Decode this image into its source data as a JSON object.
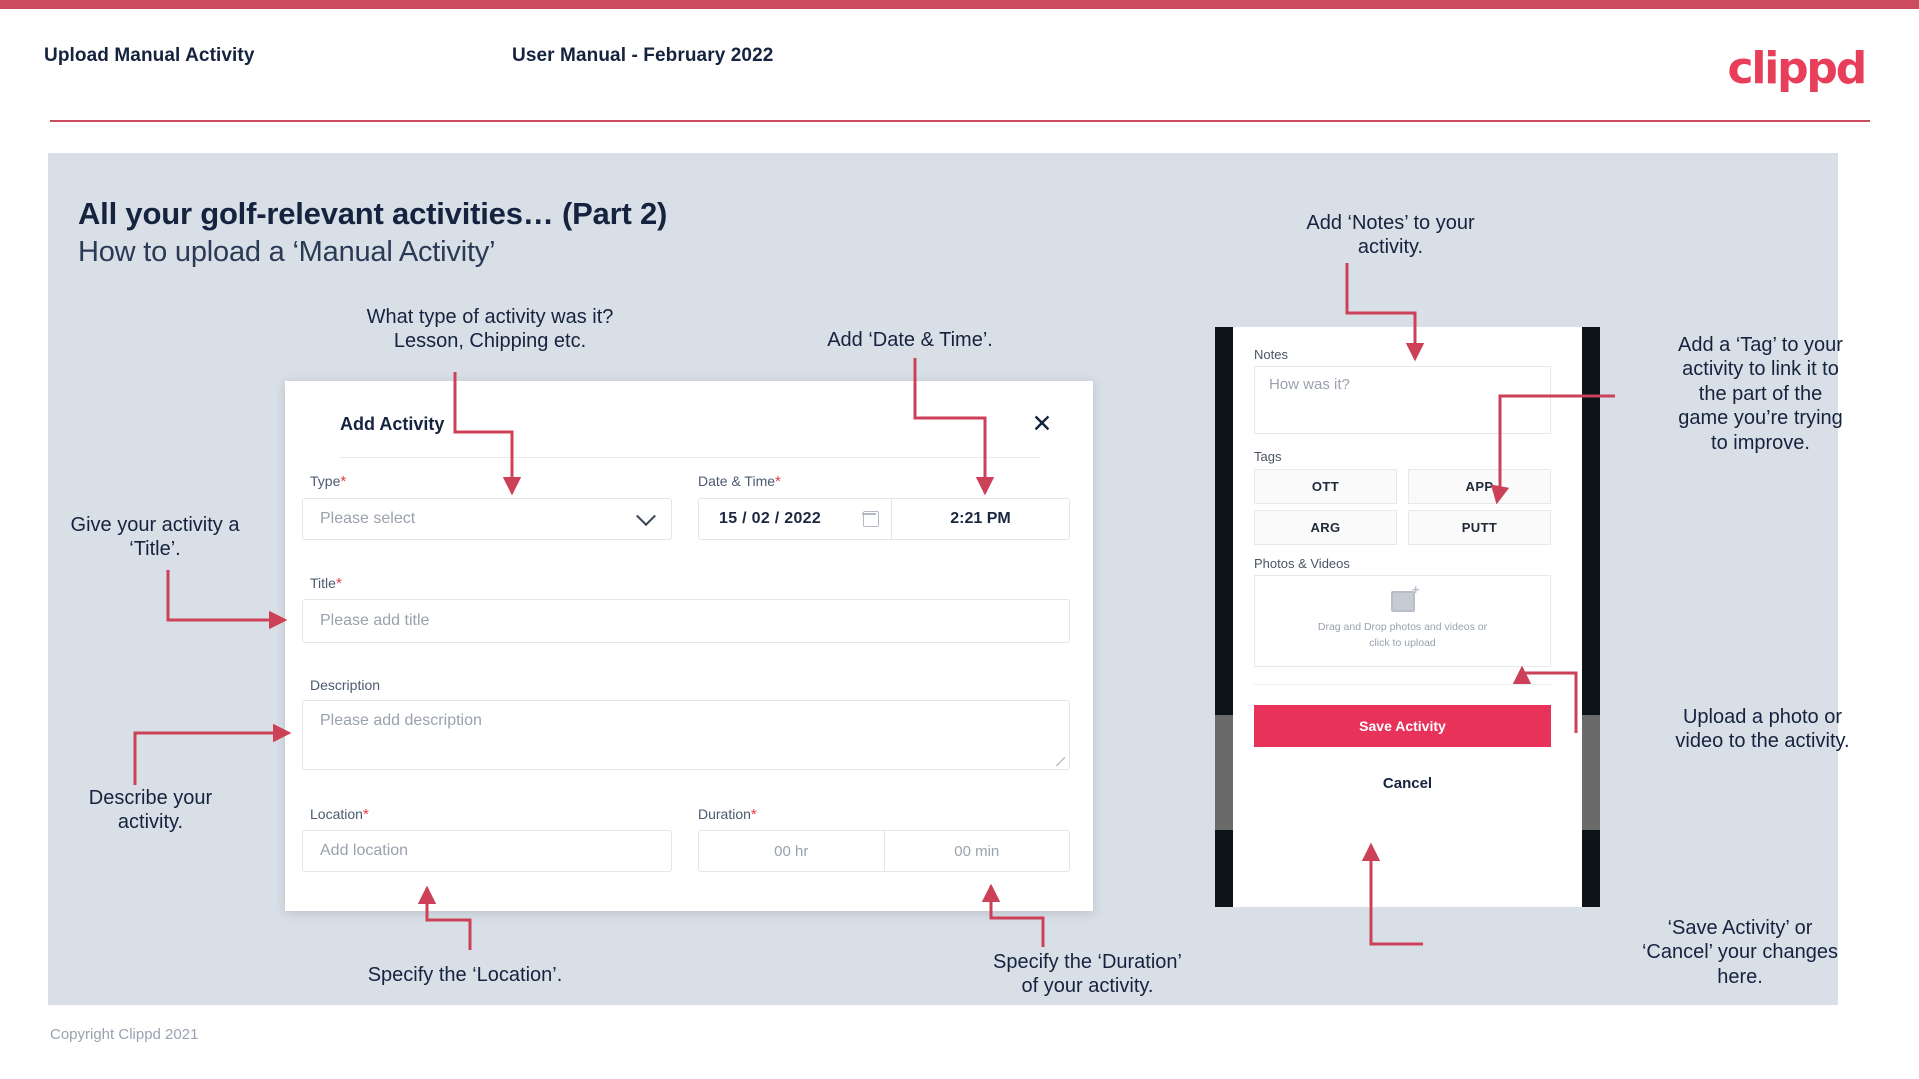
{
  "header": {
    "left_title": "Upload Manual Activity",
    "center_title": "User Manual - February 2022",
    "logo": "clippd"
  },
  "slide": {
    "title": "All your golf-relevant activities… (Part 2)",
    "subtitle": "How to upload a ‘Manual Activity’",
    "footer": "Copyright Clippd 2021"
  },
  "dialog": {
    "title": "Add Activity",
    "close_icon": "close-icon",
    "fields": {
      "type": {
        "label": "Type",
        "required": "*",
        "placeholder": "Please select",
        "chevron_icon": "chevron-down-icon"
      },
      "datetime": {
        "label": "Date & Time",
        "required": "*",
        "date": "15 /  02  / 2022",
        "calendar_icon": "calendar-icon",
        "time": "2:21 PM"
      },
      "title": {
        "label": "Title",
        "required": "*",
        "placeholder": "Please add title"
      },
      "description": {
        "label": "Description",
        "placeholder": "Please add description"
      },
      "location": {
        "label": "Location",
        "required": "*",
        "placeholder": "Add location"
      },
      "duration": {
        "label": "Duration",
        "required": "*",
        "hours": "00 hr",
        "minutes": "00 min"
      }
    }
  },
  "phone": {
    "notes": {
      "label": "Notes",
      "placeholder": "How was it?"
    },
    "tags": {
      "label": "Tags",
      "items": [
        "OTT",
        "APP",
        "ARG",
        "PUTT"
      ]
    },
    "photos": {
      "label": "Photos & Videos",
      "icon": "image-add-icon",
      "dropzone_line1": "Drag and Drop photos and videos or",
      "dropzone_line2": "click to upload"
    },
    "save_label": "Save Activity",
    "cancel_label": "Cancel"
  },
  "annotations": {
    "type": "What type of activity was it?\nLesson, Chipping etc.",
    "datetime": "Add ‘Date & Time’.",
    "title": "Give your activity a\n‘Title’.",
    "description": "Describe your\nactivity.",
    "location": "Specify the ‘Location’.",
    "duration": "Specify the ‘Duration’\nof your activity.",
    "notes": "Add ‘Notes’ to your\nactivity.",
    "tags": "Add a ‘Tag’ to your\nactivity to link it to\nthe part of the\ngame you’re trying\nto improve.",
    "photos": "Upload a photo or\nvideo to the activity.",
    "save": "‘Save Activity’ or\n‘Cancel’ your changes\nhere."
  },
  "colors": {
    "brand": "#e8325a",
    "accent_bar": "#cc4b5e",
    "stage": "#d9dfe7",
    "ink": "#15233f"
  }
}
